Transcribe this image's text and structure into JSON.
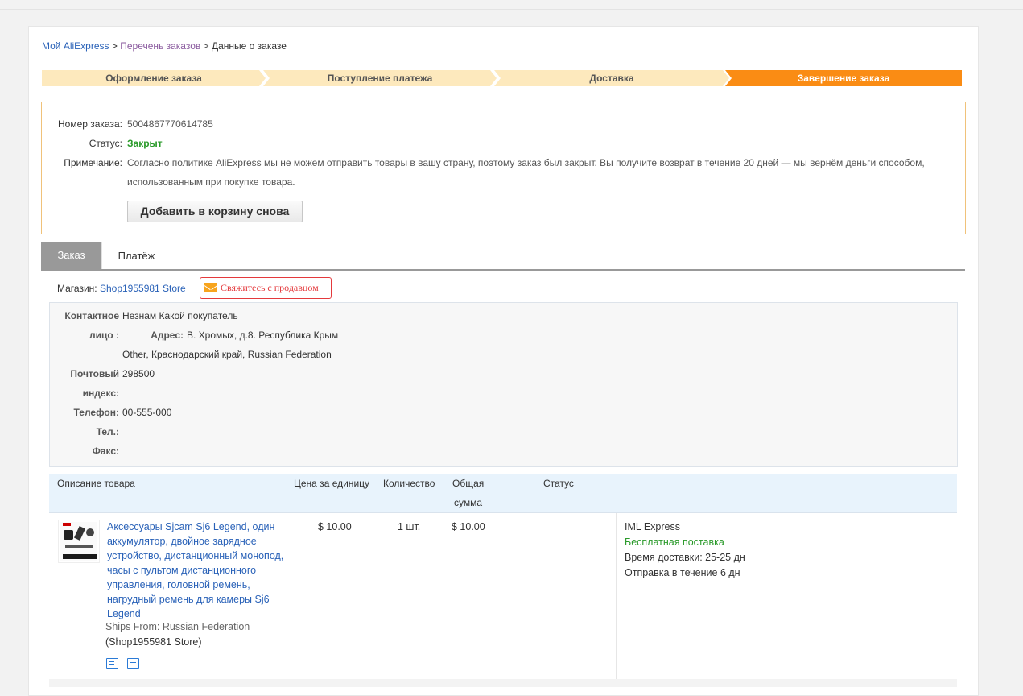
{
  "breadcrumb": {
    "home": "Мой AliExpress",
    "sep1": ">",
    "orders": "Перечень заказов",
    "sep2": ">",
    "current": "Данные о заказе"
  },
  "steps": [
    "Оформление заказа",
    "Поступление платежа",
    "Доставка",
    "Завершение заказа"
  ],
  "order": {
    "number_label": "Номер заказа:",
    "number": "5004867770614785",
    "status_label": "Статус:",
    "status": "Закрыт",
    "note_label": "Примечание:",
    "note": "Согласно политике AliExpress мы не можем отправить товары в вашу страну, поэтому заказ был закрыт. Вы получите возврат в течение 20 дней — мы вернём деньги способом, использованным при покупке товара.",
    "readd_button": "Добавить в корзину снова"
  },
  "tabs": [
    "Заказ",
    "Платёж"
  ],
  "store": {
    "label": "Магазин:",
    "name": "Shop1955981 Store",
    "contact_button": "Свяжитесь с продавцом"
  },
  "contact": {
    "person_label_1": "Контактное",
    "person_label_2": "лицо :",
    "person": "Незнам Какой покупатель",
    "address_label": "Адрес:",
    "address_1": "В. Хромых, д.8. Республика Крым",
    "address_2": "Other, Краснодарский край, Russian Federation",
    "zip_label_1": "Почтовый",
    "zip_label_2": "индекс:",
    "zip": "298500",
    "phone_label": "Телефон:",
    "phone": "00-555-000",
    "tel_label": "Тел.:",
    "tel": "",
    "fax_label": "Факс:",
    "fax": ""
  },
  "table": {
    "headers": {
      "desc": "Описание товара",
      "price": "Цена за единицу",
      "qty": "Количество",
      "total_1": "Общая",
      "total_2": "сумма",
      "status": "Статус"
    },
    "rows": [
      {
        "product": "Аксессуары Sjcam Sj6 Legend, один аккумулятор, двойное зарядное устройство, дистанционный монопод, часы с пультом дистанционного управления, головной ремень, нагрудный ремень для камеры Sj6 Legend",
        "ships_from": "Ships From: Russian Federation",
        "seller": "(Shop1955981 Store)",
        "price": "$ 10.00",
        "qty": "1 шт.",
        "total": "$ 10.00",
        "status": "",
        "shipping": {
          "carrier": "IML Express",
          "free": "Бесплатная поставка",
          "delivery_time": "Время доставки: 25-25 дн",
          "dispatch": "Отправка в течение 6 дн"
        }
      }
    ]
  },
  "icons": {
    "mail": "mail-icon",
    "shipping": "truck-icon",
    "snapshot": "snapshot-icon"
  },
  "colors": {
    "accent": "#fa8c14",
    "link": "#2a62b8",
    "success": "#2a9a2a",
    "danger": "#e4393c"
  }
}
